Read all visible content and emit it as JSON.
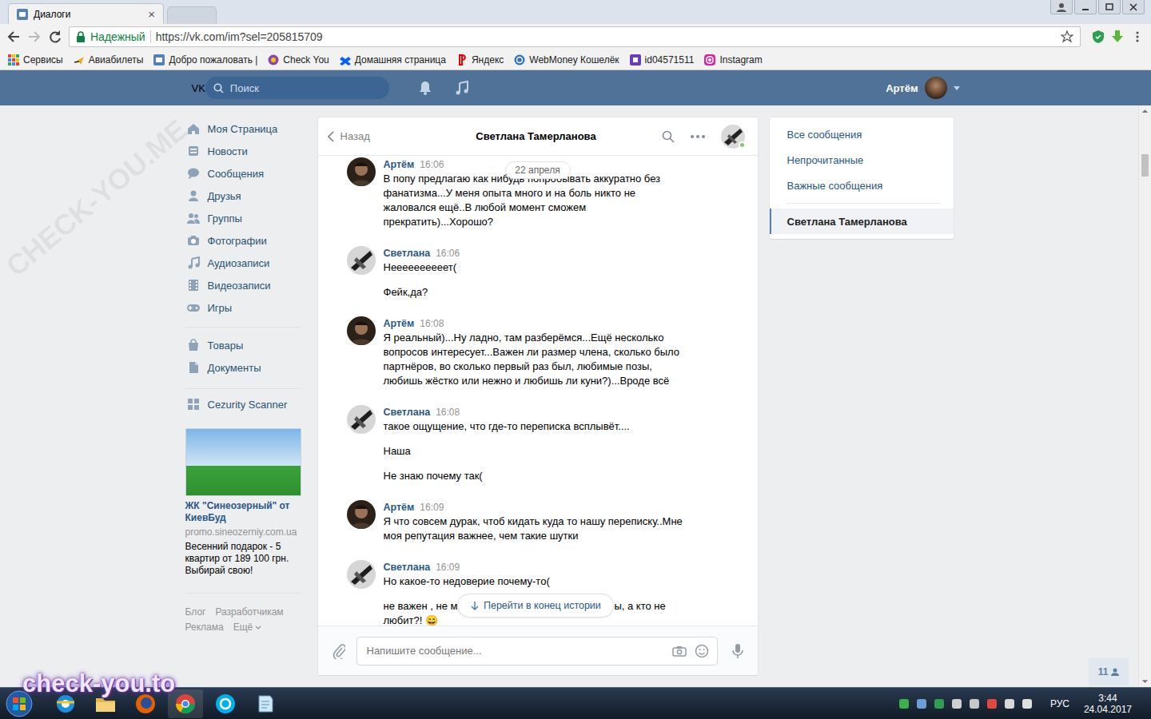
{
  "browser": {
    "tabs": [
      {
        "label": "Диалоги",
        "close": "×",
        "selected": true
      },
      {
        "selected": false
      }
    ],
    "address": {
      "security": "Надежный",
      "url": "https://vk.com/im?sel=205815709"
    },
    "bookmarks": [
      "Сервисы",
      "Авиабилеты",
      "Добро пожаловать |",
      "Check You",
      "Домашняя страница",
      "Яндекс",
      "WebMoney Кошелёк",
      "id04571511",
      "Instagram"
    ]
  },
  "vk": {
    "logo": "VK",
    "search_placeholder": "Поиск",
    "user": "Артём"
  },
  "nav_groups": [
    [
      "Моя Страница",
      "Новости",
      "Сообщения",
      "Друзья",
      "Группы",
      "Фотографии",
      "Аудиозаписи",
      "Видеозаписи",
      "Игры"
    ],
    [
      "Товары",
      "Документы"
    ],
    [
      "Cezurity Scanner"
    ]
  ],
  "ad": {
    "title": "ЖК \"Синеозерный\" от КиевБуд",
    "domain": "promo.sineozerniy.com.ua",
    "text": "Весенний подарок - 5 квартир от 189 100 грн. Выбирай свою!"
  },
  "footer": [
    "Блог",
    "Разработчикам",
    "Реклама",
    "Ещё"
  ],
  "chat": {
    "back": "Назад",
    "title": "Светлана Тамерланова",
    "peer_online": true,
    "date": "22 апреля",
    "messages": [
      {
        "author": "Артём",
        "time": "16:06",
        "kind": "self",
        "paragraphs": [
          [
            "В попу предлагаю как нибудь попробывать аккуратно без фанатизма...У меня опыта много и на боль никто не жаловался ещё..В любой момент сможем прекратить)...Хорошо?"
          ]
        ]
      },
      {
        "author": "Светлана",
        "time": "16:06",
        "kind": "peer",
        "paragraphs": [
          [
            "Неееееееееет("
          ],
          [
            "Фейк,да?"
          ]
        ]
      },
      {
        "author": "Артём",
        "time": "16:08",
        "kind": "self",
        "paragraphs": [
          [
            "Я реальный)...Ну ладно, там разберёмся...Ещё несколько вопросов интересует...Важен ли размер члена, сколько было партнёров, во сколько первый раз был, любимые позы, любишь жёстко или нежно и любишь ли куни?)...Вроде всё"
          ]
        ]
      },
      {
        "author": "Светлана",
        "time": "16:08",
        "kind": "peer",
        "paragraphs": [
          [
            "такое ощущение, что где-то переписка всплывёт...."
          ],
          [
            "Наша"
          ],
          [
            "Не знаю почему так("
          ]
        ]
      },
      {
        "author": "Артём",
        "time": "16:09",
        "kind": "self",
        "paragraphs": [
          [
            "Я что совсем дурак, чтоб кидать куда то нашу переписку..Мне моя репутация важнее, чем такие шутки"
          ]
        ]
      },
      {
        "author": "Светлана",
        "time": "16:09",
        "kind": "peer",
        "paragraphs": [
          [
            "Но какое-то недоверие почему-то("
          ],
          [
            "не важен , не м",
            "ы, а кто не любит?! 😄"
          ]
        ]
      }
    ],
    "jump": "Перейти в конец истории",
    "composer_placeholder": "Напишите сообщение..."
  },
  "chat_filters": [
    {
      "label": "Все сообщения",
      "kind": "filter",
      "selected": false
    },
    {
      "label": "Непрочитанные",
      "kind": "filter",
      "selected": false
    },
    {
      "label": "Важные сообщения",
      "kind": "filter",
      "selected": false
    },
    {
      "label": "Светлана Тамерланова",
      "kind": "dialog",
      "selected": true
    }
  ],
  "online_badge": "11",
  "page_scroll": {
    "level": 0.07
  },
  "watermarks": {
    "diagonal": "CHECK-YOU.ME",
    "corner": "check-you.to"
  },
  "taskbar": {
    "lang": "РУС",
    "time": "3:44",
    "date": "24.04.2017"
  }
}
